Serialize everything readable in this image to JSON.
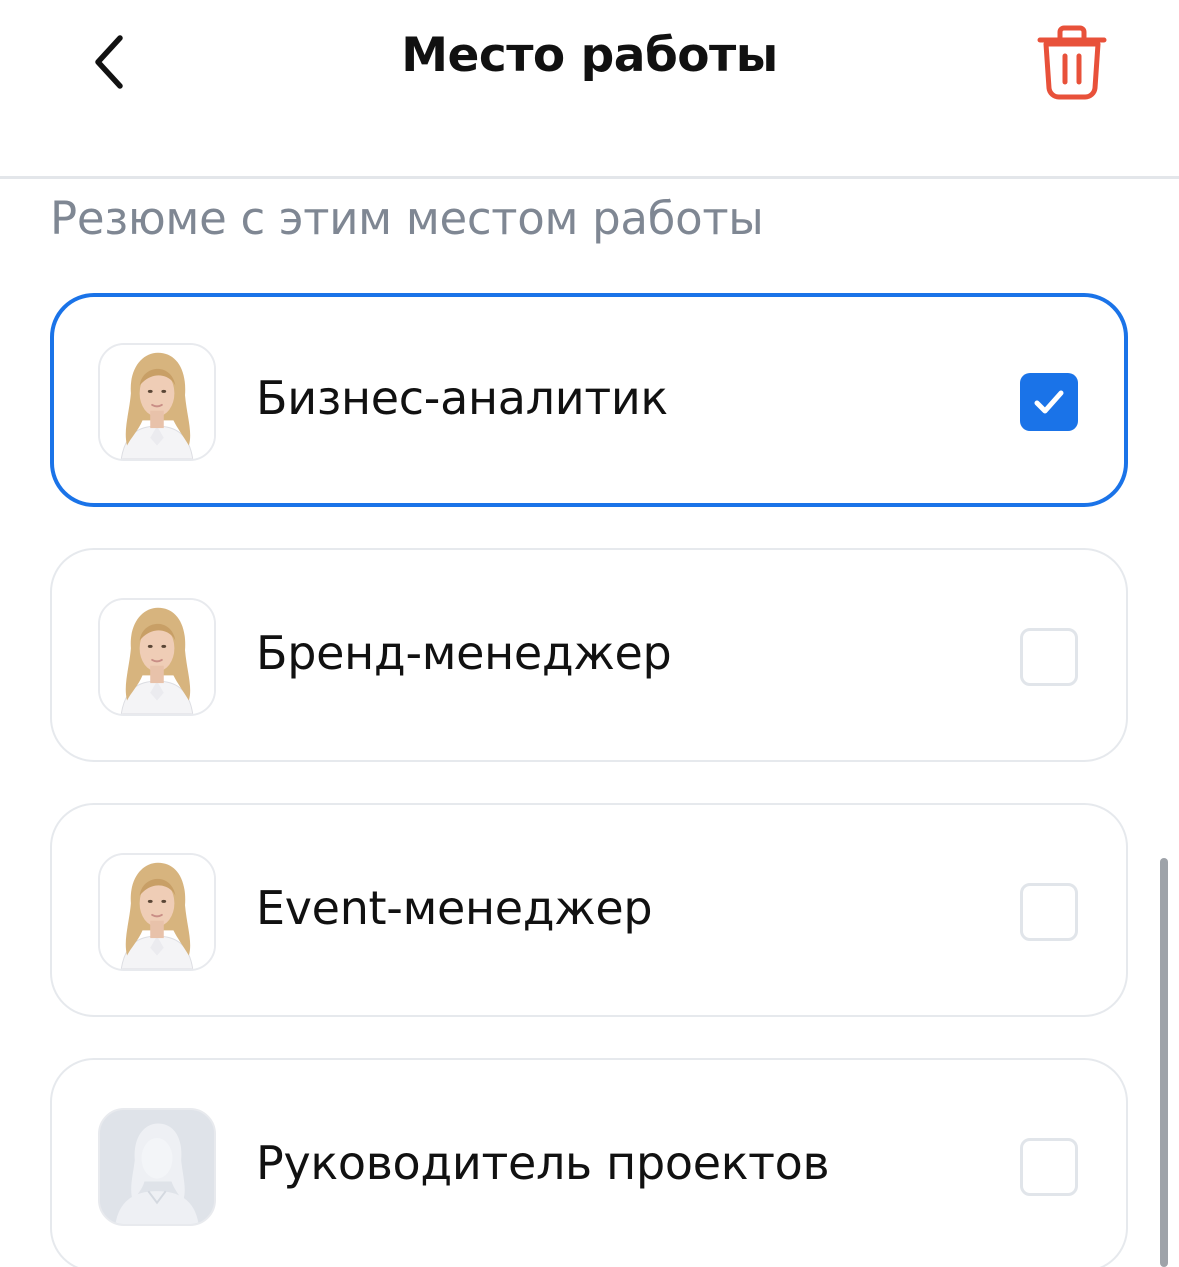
{
  "header": {
    "back_icon": "chevron-left-icon",
    "title": "Место работы",
    "delete_icon": "trash-icon",
    "delete_color": "#e8513a"
  },
  "section": {
    "label": "Резюме с этим местом работы"
  },
  "resumes": [
    {
      "label": "Бизнес-аналитик",
      "avatar": "photo",
      "checked": true
    },
    {
      "label": "Бренд-менеджер",
      "avatar": "photo",
      "checked": false
    },
    {
      "label": "Event-менеджер",
      "avatar": "photo",
      "checked": false
    },
    {
      "label": "Руководитель проектов",
      "avatar": "placeholder-silhouette",
      "checked": false
    }
  ],
  "colors": {
    "accent": "#1a73e8",
    "muted_text": "#7f8793",
    "border": "#e6e9ed"
  }
}
